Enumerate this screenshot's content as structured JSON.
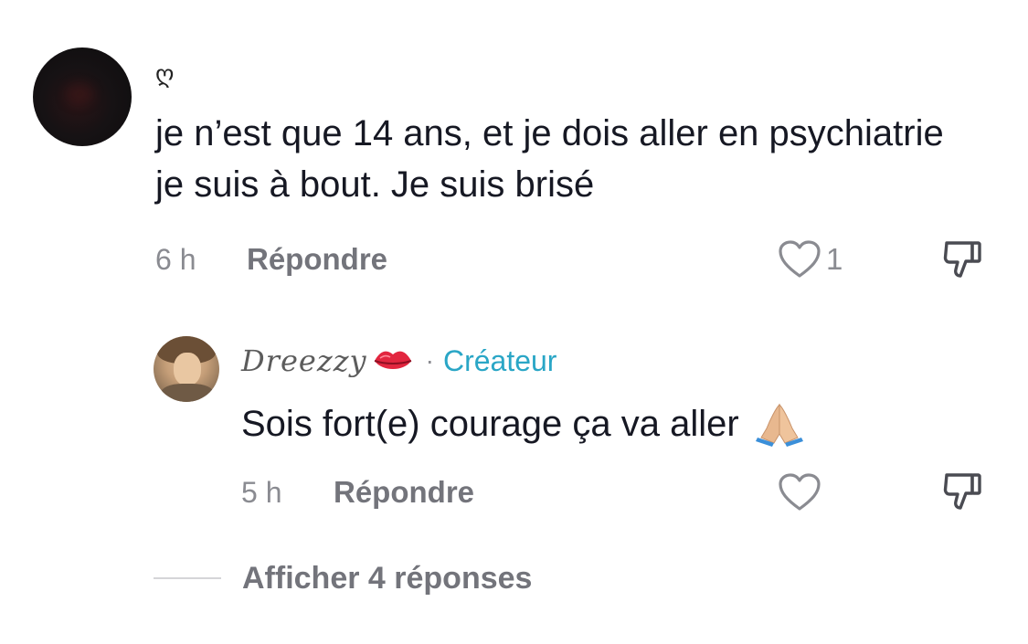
{
  "main_comment": {
    "username": "ღ",
    "text": "je n’est que 14 ans, et je dois aller en psychiatrie je suis à bout. Je suis brisé",
    "time": "6 h",
    "reply_label": "Répondre",
    "like_count": "1",
    "avatar": "dark-avatar"
  },
  "reply": {
    "username": "Dreezzy",
    "username_emoji": "lips-kiss-icon",
    "separator": "·",
    "badge": "Créateur",
    "text": "Sois fort(e) courage ça va aller",
    "text_emoji": "folded-hands-icon",
    "time": "5 h",
    "reply_label": "Répondre",
    "avatar": "user-photo-avatar"
  },
  "show_replies_label": "Afficher 4 réponses",
  "colors": {
    "primary_text": "#161823",
    "secondary_text": "#73747b",
    "creator_badge": "#2aa6c6",
    "background": "#ffffff"
  }
}
